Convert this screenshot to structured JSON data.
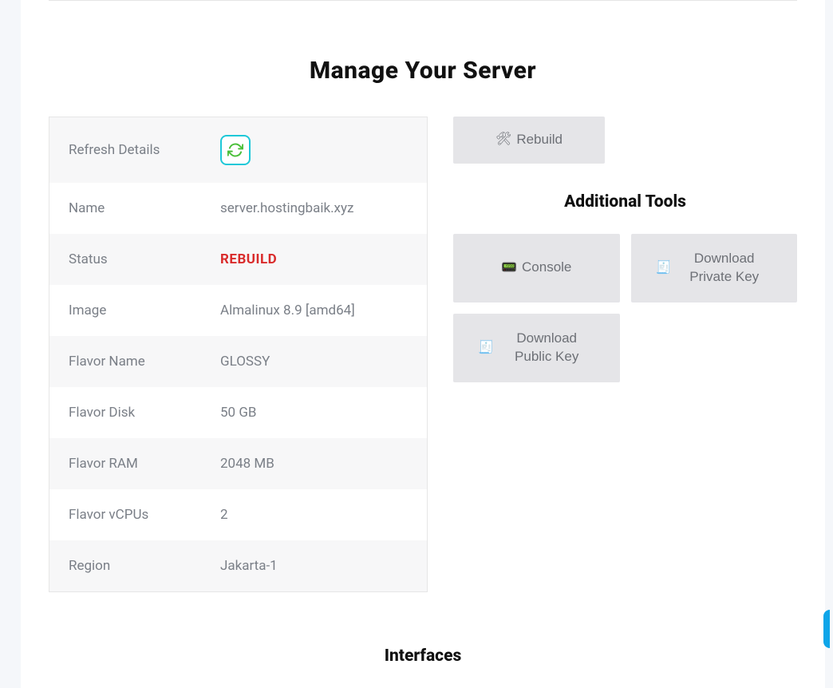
{
  "page": {
    "title": "Manage Your Server",
    "interfaces_heading": "Interfaces"
  },
  "details": {
    "refresh_label": "Refresh Details",
    "rows": {
      "name": {
        "label": "Name",
        "value": "server.hostingbaik.xyz"
      },
      "status": {
        "label": "Status",
        "value": "REBUILD"
      },
      "image": {
        "label": "Image",
        "value": "Almalinux 8.9 [amd64]"
      },
      "flavor_name": {
        "label": "Flavor Name",
        "value": "GLOSSY"
      },
      "flavor_disk": {
        "label": "Flavor Disk",
        "value": "50 GB"
      },
      "flavor_ram": {
        "label": "Flavor RAM",
        "value": "2048 MB"
      },
      "flavor_vcpu": {
        "label": "Flavor vCPUs",
        "value": "2"
      },
      "region": {
        "label": "Region",
        "value": "Jakarta-1"
      }
    }
  },
  "actions": {
    "rebuild_label": "Rebuild"
  },
  "tools": {
    "heading": "Additional Tools",
    "console_label": "Console",
    "download_private_key_label": "Download Private Key",
    "download_public_key_label": "Download Public Key"
  },
  "icons": {
    "refresh": "refresh-icon",
    "rebuild": "🛠",
    "console": "📟",
    "document": "🧾"
  }
}
